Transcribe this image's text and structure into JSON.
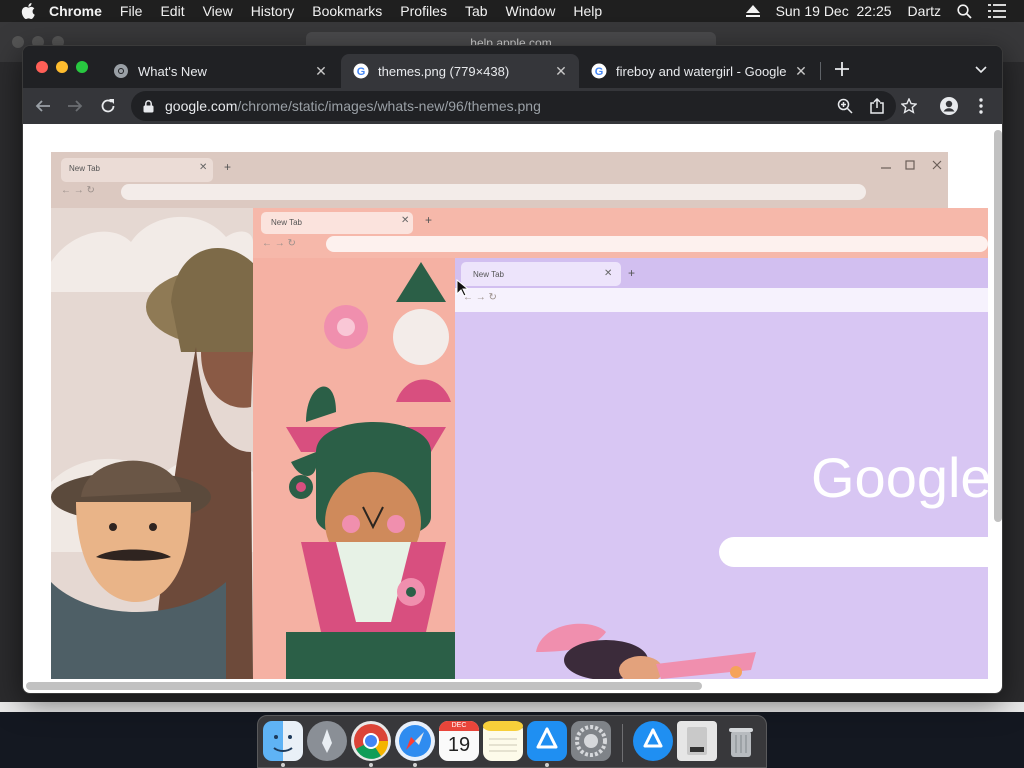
{
  "menubar": {
    "app": "Chrome",
    "items": [
      "File",
      "Edit",
      "View",
      "History",
      "Bookmarks",
      "Profiles",
      "Tab",
      "Window",
      "Help"
    ],
    "datetime": "Sun 19 Dec  22:25",
    "user": "Dartz"
  },
  "background_window": {
    "url": "help.apple.com"
  },
  "tabs": [
    {
      "title": "What's New",
      "active": false
    },
    {
      "title": "themes.png (779×438)",
      "active": true
    },
    {
      "title": "fireboy and watergirl - Google",
      "active": false
    }
  ],
  "omnibox": {
    "domain": "google.com",
    "path": "/chrome/static/images/whats-new/96/themes.png"
  },
  "image": {
    "mini_tab_label": "New Tab",
    "google_logo": "Google"
  },
  "dock": {
    "calendar_month": "DEC",
    "calendar_day": "19",
    "apps": [
      "finder",
      "launchpad",
      "chrome",
      "safari",
      "calendar",
      "notes",
      "app-store",
      "system-preferences",
      "app-store-downloads",
      "disk-utility",
      "trash"
    ]
  },
  "colors": {
    "menubar": "#1f1f1f",
    "tabstrip": "#202124",
    "active_tab": "#35363a",
    "theme_beige": "#dcc9c1",
    "theme_peach": "#f4a99d",
    "theme_lavender": "#d8c6f3"
  }
}
